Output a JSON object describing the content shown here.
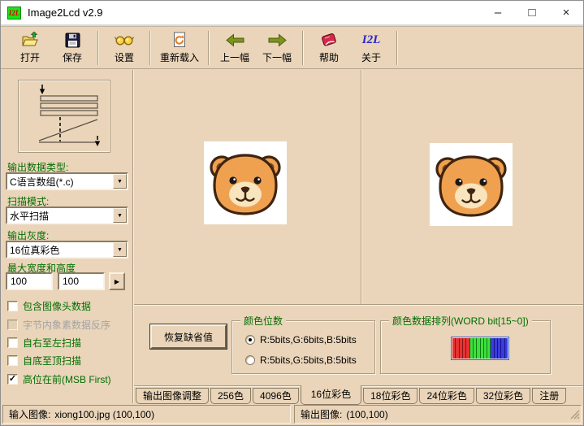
{
  "window": {
    "title": "Image2Lcd v2.9",
    "icon_label": "I2L",
    "minimize_glyph": "–",
    "maximize_glyph": "□",
    "close_glyph": "×"
  },
  "toolbar": {
    "open_label": "打开",
    "save_label": "保存",
    "settings_label": "设置",
    "reload_label": "重新载入",
    "prev_label": "上一幅",
    "next_label": "下一幅",
    "help_label": "帮助",
    "about_label": "关于",
    "about_icon_text": "I2L"
  },
  "left_panel": {
    "output_type_label": "输出数据类型:",
    "output_type_value": "C语言数组(*.c)",
    "scan_mode_label": "扫描模式:",
    "scan_mode_value": "水平扫描",
    "gray_label": "输出灰度:",
    "gray_value": "16位真彩色",
    "max_size_label": "最大宽度和高度",
    "max_width": "100",
    "max_height": "100",
    "checkboxes": [
      {
        "label": "包含图像头数据",
        "checked": false,
        "disabled": false
      },
      {
        "label": "字节内象素数据反序",
        "checked": false,
        "disabled": true
      },
      {
        "label": "自右至左扫描",
        "checked": false,
        "disabled": false
      },
      {
        "label": "自底至顶扫描",
        "checked": false,
        "disabled": false
      },
      {
        "label": "高位在前(MSB First)",
        "checked": true,
        "disabled": false
      }
    ]
  },
  "settings_panel": {
    "restore_defaults_label": "恢复缺省值",
    "color_bits_group_label": "颜色位数",
    "radio_565_label": "R:5bits,G:6bits,B:5bits",
    "radio_555_label": "R:5bits,G:5bits,B:5bits",
    "selected_radio": "R:5bits,G:6bits,B:5bits",
    "arrangement_group_label": "颜色数据排列(WORD bit[15~0])",
    "word_bits": {
      "red": 5,
      "green": 6,
      "blue": 5
    },
    "bar_colors": {
      "red": "#e63232",
      "green": "#3ce03c",
      "blue": "#3b3bdc",
      "border": "#3a5fcd"
    }
  },
  "tabs": [
    {
      "label": "输出图像调整",
      "active": false
    },
    {
      "label": "256色",
      "active": false
    },
    {
      "label": "4096色",
      "active": false
    },
    {
      "label": "16位彩色",
      "active": true
    },
    {
      "label": "18位彩色",
      "active": false
    },
    {
      "label": "24位彩色",
      "active": false
    },
    {
      "label": "32位彩色",
      "active": false
    },
    {
      "label": "注册",
      "active": false
    }
  ],
  "statusbar": {
    "input_label": "输入图像:",
    "input_value": "xiong100.jpg (100,100)",
    "output_label": "输出图像:",
    "output_value": "(100,100)"
  },
  "theme": {
    "background": "#ead5ba",
    "label_green": "#006e00",
    "titlebar": "#ffffff"
  }
}
